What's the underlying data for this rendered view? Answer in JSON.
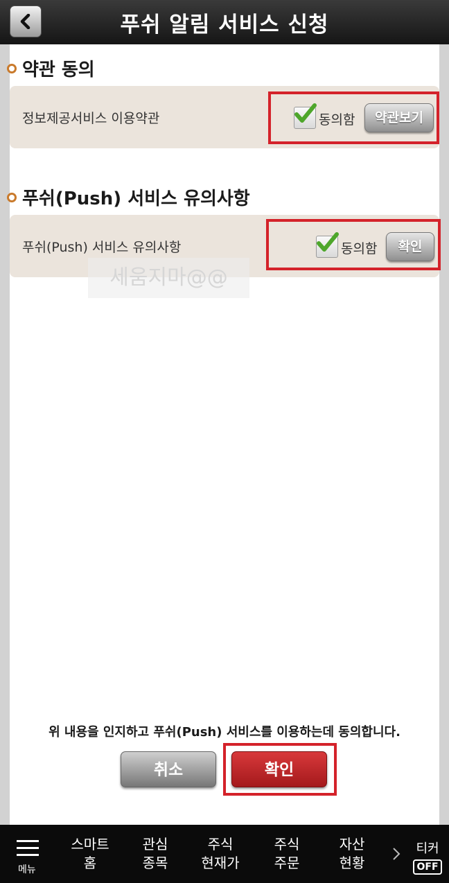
{
  "header": {
    "title": "푸쉬 알림 서비스 신청"
  },
  "sections": [
    {
      "title": "약관 동의",
      "row_label": "정보제공서비스 이용약관",
      "agree_label": "동의함",
      "button_label": "약관보기",
      "checked": true
    },
    {
      "title": "푸쉬(Push) 서비스 유의사항",
      "row_label": "푸쉬(Push) 서비스 유의사항",
      "agree_label": "동의함",
      "button_label": "확인",
      "checked": true
    }
  ],
  "watermark": "세움지마@@",
  "notice": "위 내용을 인지하고 푸쉬(Push) 서비스를 이용하는데 동의합니다.",
  "buttons": {
    "cancel": "취소",
    "confirm": "확인"
  },
  "bottom_nav": {
    "menu": "메뉴",
    "items": [
      {
        "line1": "스마트",
        "line2": "홈"
      },
      {
        "line1": "관심",
        "line2": "종목"
      },
      {
        "line1": "주식",
        "line2": "현재가"
      },
      {
        "line1": "주식",
        "line2": "주문"
      },
      {
        "line1": "자산",
        "line2": "현황"
      }
    ],
    "ticker": "티커",
    "ticker_state": "OFF"
  },
  "colors": {
    "highlight": "#d4222a",
    "confirm": "#c0282b",
    "bullet": "#c97a2c"
  }
}
